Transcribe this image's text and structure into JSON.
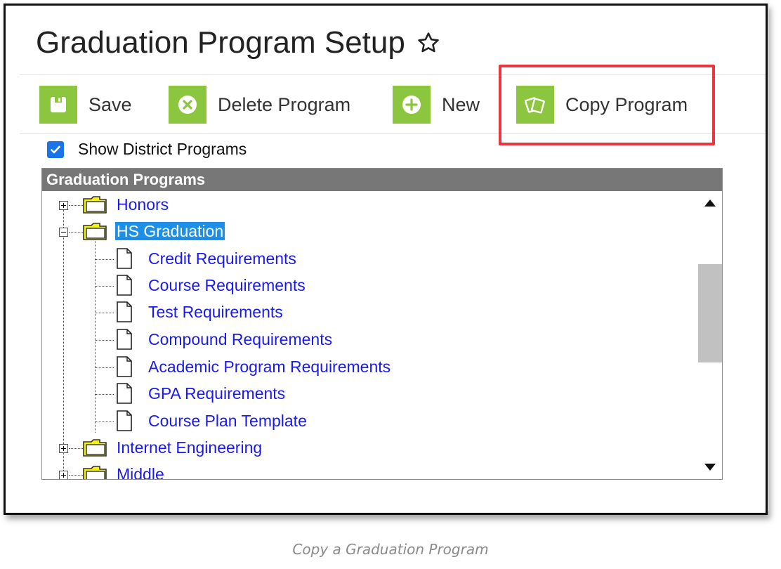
{
  "header": {
    "title": "Graduation Program Setup",
    "favorite_icon": "star-outline-icon"
  },
  "toolbar": {
    "save": {
      "label": "Save",
      "icon": "save-disk-icon"
    },
    "delete_program": {
      "label": "Delete Program",
      "icon": "x-circle-icon"
    },
    "new": {
      "label": "New",
      "icon": "plus-circle-icon"
    },
    "copy_program": {
      "label": "Copy Program",
      "icon": "copy-documents-icon"
    },
    "accent_color": "#8cc63f",
    "highlight_color": "#e8383d"
  },
  "filters": {
    "show_district_programs_label": "Show District Programs",
    "show_district_programs_checked": true
  },
  "tree": {
    "title": "Graduation Programs",
    "nodes": [
      {
        "label": "Honors",
        "expanded": false
      },
      {
        "label": "HS Graduation",
        "expanded": true,
        "selected": true,
        "children": [
          "Credit Requirements",
          "Course Requirements",
          "Test Requirements",
          "Compound Requirements",
          "Academic Program Requirements",
          "GPA Requirements",
          "Course Plan Template"
        ]
      },
      {
        "label": "Internet Engineering",
        "expanded": false
      },
      {
        "label": "Middle",
        "expanded": false
      }
    ]
  },
  "caption": "Copy a Graduation Program"
}
